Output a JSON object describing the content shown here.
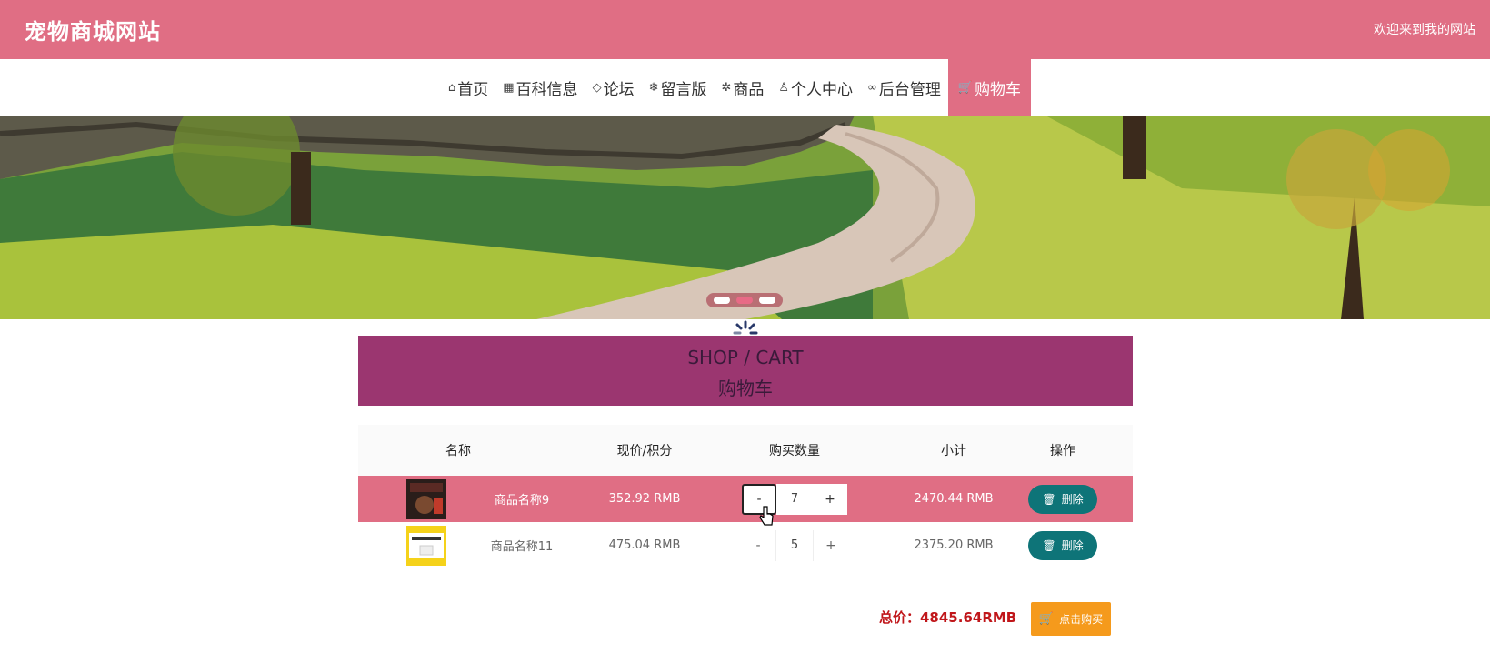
{
  "header": {
    "site_title": "宠物商城网站",
    "welcome": "欢迎来到我的网站",
    "bg_color": "#e06e84"
  },
  "nav": {
    "items": [
      {
        "label": "首页",
        "icon": "home-icon",
        "active": false
      },
      {
        "label": "百科信息",
        "icon": "grid-icon",
        "active": false
      },
      {
        "label": "论坛",
        "icon": "tag-icon",
        "active": false
      },
      {
        "label": "留言版",
        "icon": "snowflake-icon",
        "active": false
      },
      {
        "label": "商品",
        "icon": "gear-icon",
        "active": false
      },
      {
        "label": "个人中心",
        "icon": "user-icon",
        "active": false
      },
      {
        "label": "后台管理",
        "icon": "link-icon",
        "active": false
      },
      {
        "label": "购物车",
        "icon": "cart-icon",
        "active": true
      }
    ]
  },
  "banner": {
    "slides": 3,
    "active_slide": 2
  },
  "cart": {
    "title_en": "SHOP / CART",
    "title_cn": "购物车",
    "header_color": "#9b3670",
    "columns": [
      "名称",
      "现价/积分",
      "购买数量",
      "小计",
      "操作"
    ],
    "rows": [
      {
        "name": "商品名称9",
        "price": "352.92 RMB",
        "qty": "7",
        "subtotal": "2470.44 RMB",
        "delete_label": "删除",
        "highlighted": true
      },
      {
        "name": "商品名称11",
        "price": "475.04 RMB",
        "qty": "5",
        "subtotal": "2375.20 RMB",
        "delete_label": "删除",
        "highlighted": false
      }
    ],
    "qty_minus": "-",
    "qty_plus": "+",
    "total_label": "总价：4845.64RMB",
    "buy_label": "点击购买",
    "delete_color": "#0e7478",
    "buy_color": "#f59a1c"
  }
}
